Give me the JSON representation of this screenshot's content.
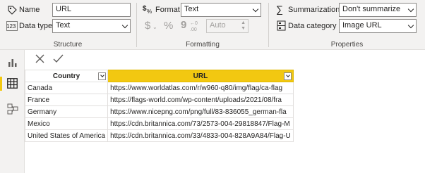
{
  "structure": {
    "group_title": "Structure",
    "name_label": "Name",
    "name_value": "URL",
    "data_type_label": "Data type",
    "data_type_value": "Text"
  },
  "formatting": {
    "group_title": "Formatting",
    "format_label": "Format",
    "format_value": "Text",
    "currency_symbol": "$",
    "percent_symbol": "%",
    "comma_symbol": "9",
    "decimal_value": "Auto"
  },
  "properties": {
    "group_title": "Properties",
    "summarization_label": "Summarization",
    "summarization_value": "Don't summarize",
    "data_category_label": "Data category",
    "data_category_value": "Image URL"
  },
  "colors": {
    "accent": "#f2c811",
    "ribbon_bg": "#f3f2f1"
  },
  "table": {
    "columns": [
      "Country",
      "URL"
    ],
    "rows": [
      [
        "Canada",
        "https://www.worldatlas.com/r/w960-q80/img/flag/ca-flag"
      ],
      [
        "France",
        "https://flags-world.com/wp-content/uploads/2021/08/fra"
      ],
      [
        "Germany",
        "https://www.nicepng.com/png/full/83-836055_german-fla"
      ],
      [
        "Mexico",
        "https://cdn.britannica.com/73/2573-004-29818847/Flag-M"
      ],
      [
        "United States of America",
        "https://cdn.britannica.com/33/4833-004-828A9A84/Flag-U"
      ]
    ]
  }
}
